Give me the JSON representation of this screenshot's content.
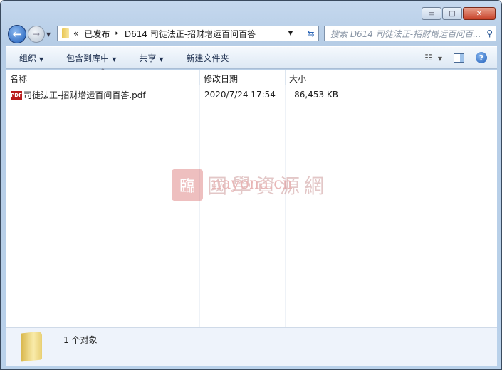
{
  "window": {
    "controls": {
      "minimize": "▭",
      "maximize": "□",
      "close": "✕"
    }
  },
  "address": {
    "prefix": "«",
    "segments": [
      "已发布",
      "D614 司徒法正-招财增运百问百答"
    ],
    "separator": "▸"
  },
  "search": {
    "placeholder": "搜索 D614 司徒法正-招财增运百问百..."
  },
  "toolbar": {
    "organize": "组织",
    "include": "包含到库中",
    "share": "共享",
    "new_folder": "新建文件夹"
  },
  "columns": {
    "name": "名称",
    "date": "修改日期",
    "size": "大小"
  },
  "files": [
    {
      "name": "司徒法正-招财增运百问百答.pdf",
      "date": "2020/7/24 17:54",
      "size": "86,453 KB",
      "icon": "pdf-icon",
      "icon_label": "PDF"
    }
  ],
  "watermark": {
    "text": "國學資源網",
    "url": "nayona.cn",
    "seal": "臨"
  },
  "status": {
    "count": "1 个对象"
  }
}
